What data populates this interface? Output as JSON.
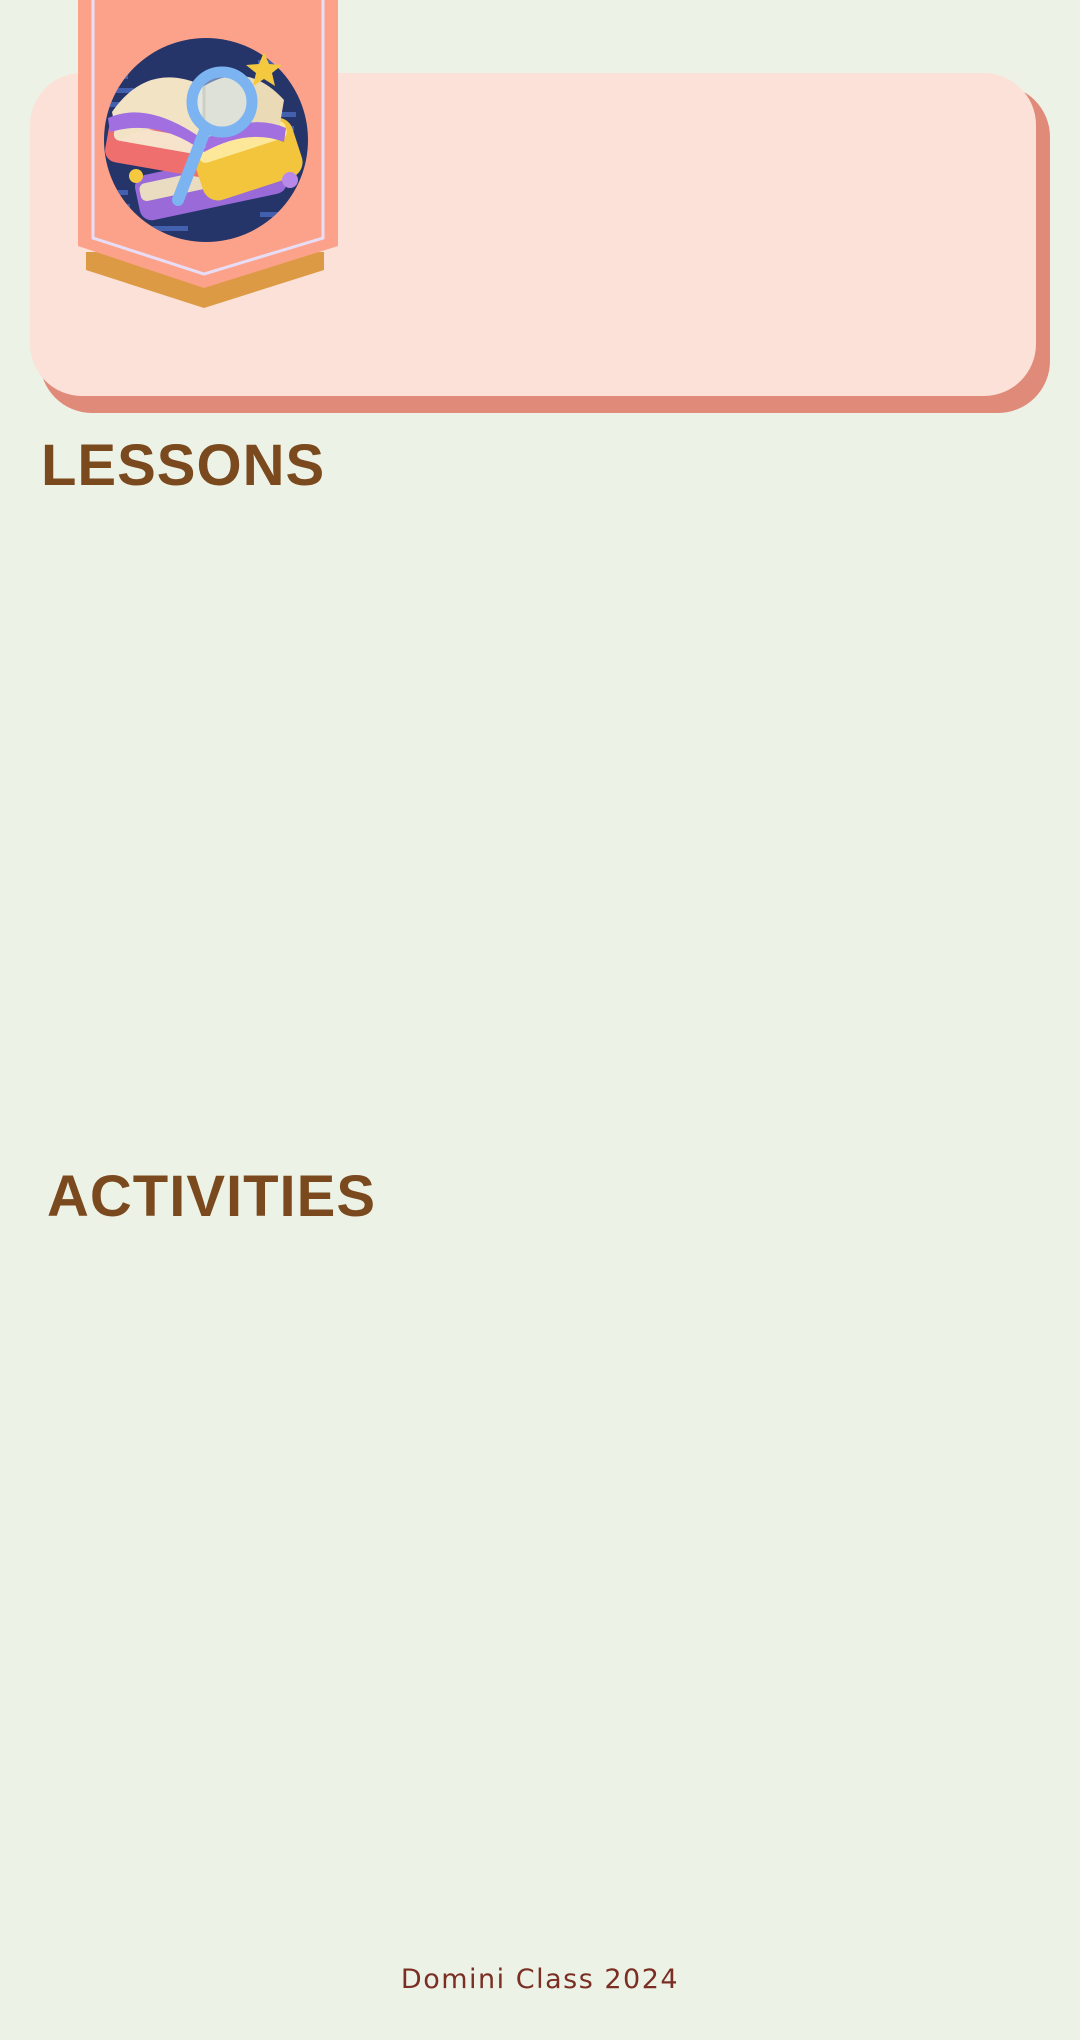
{
  "header": {
    "banner_icon": "books-magnifier-icon",
    "colors": {
      "card": "#fce1d8",
      "card_shadow": "#e08a7a",
      "banner": "#fca28a",
      "banner_trim": "#dd9a44",
      "heading": "#7a4a1e",
      "background": "#edf2e6"
    }
  },
  "sections": {
    "lessons_title": "LESSONS",
    "activities_title": "ACTIVITIES"
  },
  "footer": {
    "text": "Domini Class 2024"
  }
}
